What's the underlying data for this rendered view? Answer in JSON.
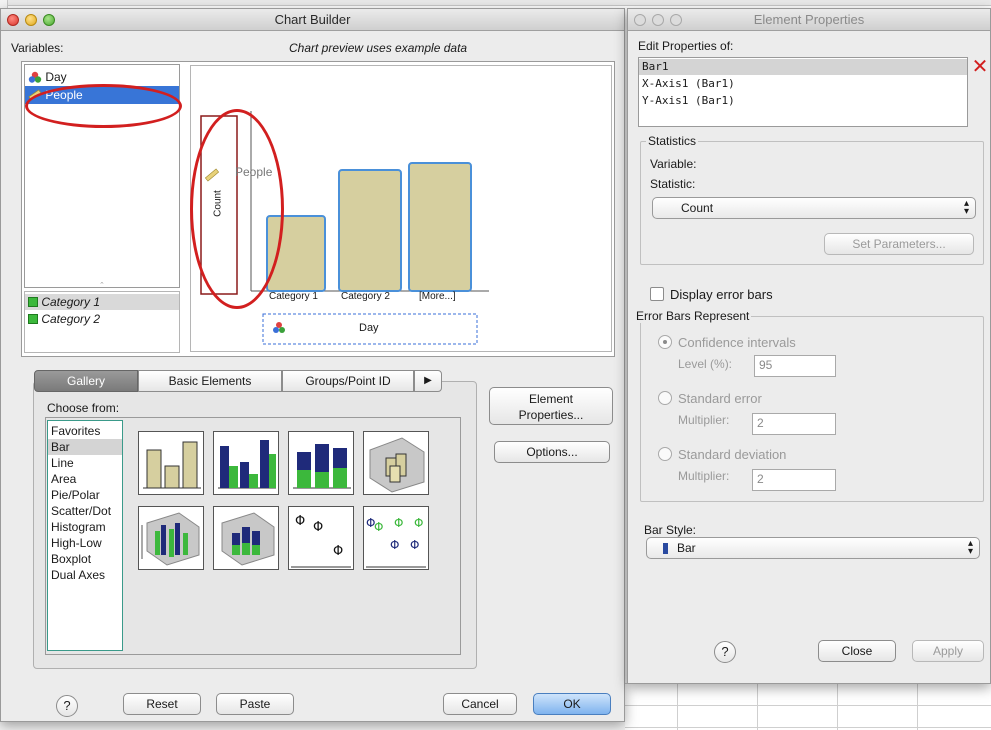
{
  "chart_builder": {
    "title": "Chart Builder",
    "variables_label": "Variables:",
    "preview_caption": "Chart preview uses example data",
    "variables": [
      {
        "icon": "nominal-icon",
        "label": "Day"
      },
      {
        "icon": "scale-ruler-icon",
        "label": "People"
      }
    ],
    "categories": [
      "Category 1",
      "Category 2"
    ],
    "preview": {
      "y_axis_title": "Count",
      "y_drop_variable": "People",
      "x_categories": [
        "Category 1",
        "Category 2",
        "[More...]"
      ],
      "x_drop_variable": "Day",
      "bar_fill": "#d6cf9f",
      "bar_outline": "#4a90d9"
    },
    "tabs": [
      "Gallery",
      "Basic Elements",
      "Groups/Point ID"
    ],
    "choose_from_label": "Choose from:",
    "chart_types": [
      "Favorites",
      "Bar",
      "Line",
      "Area",
      "Pie/Polar",
      "Scatter/Dot",
      "Histogram",
      "High-Low",
      "Boxplot",
      "Dual Axes"
    ],
    "selected_chart_type": "Bar",
    "element_properties_button": "Element Properties...",
    "options_button": "Options...",
    "help_button": "?",
    "reset_button": "Reset",
    "paste_button": "Paste",
    "cancel_button": "Cancel",
    "ok_button": "OK"
  },
  "element_properties": {
    "title": "Element Properties",
    "edit_label": "Edit Properties of:",
    "elements": [
      "Bar1",
      "X-Axis1 (Bar1)",
      "Y-Axis1 (Bar1)"
    ],
    "selected_element": "Bar1",
    "statistics_group": "Statistics",
    "variable_label": "Variable:",
    "statistic_label": "Statistic:",
    "statistic_value": "Count",
    "set_parameters_button": "Set Parameters...",
    "display_error_bars_label": "Display error bars",
    "error_bars_group": "Error Bars Represent",
    "confidence_label": "Confidence intervals",
    "level_label": "Level (%):",
    "level_value": "95",
    "std_error_label": "Standard error",
    "std_dev_label": "Standard deviation",
    "multiplier_label": "Multiplier:",
    "multiplier_value": "2",
    "bar_style_label": "Bar Style:",
    "bar_style_value": "Bar",
    "help_button": "?",
    "close_button": "Close",
    "apply_button": "Apply"
  },
  "colors": {
    "selection": "#3875d7",
    "annotation": "#d21f1f",
    "count_box": "#8b1a1a"
  }
}
